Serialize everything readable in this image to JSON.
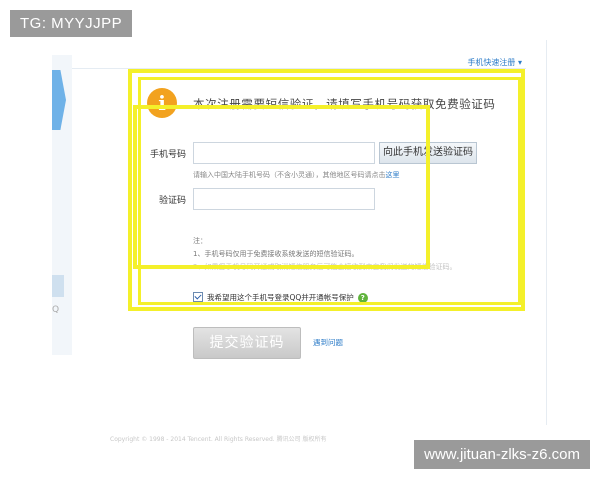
{
  "watermark": {
    "top_left": "TG: MYYJJPP",
    "bottom_right": "www.jituan-zlks-z6.com"
  },
  "top_link": "手机快速注册 ▾",
  "left_search_glyph": "Q",
  "header": {
    "info_symbol": "i",
    "text": "本次注册需要短信验证，请填写手机号码获取免费验证码"
  },
  "phone": {
    "label": "手机号码",
    "value": "",
    "send_button": "向此手机发送验证码",
    "hint_prefix": "请输入中国大陆手机号码（不含小灵通），其他地区号码请点击",
    "hint_link": "这里"
  },
  "code": {
    "label": "验证码",
    "value": ""
  },
  "notes": {
    "title": "注：",
    "item1": "1、手机号码仅用于免费接收系统发送的短信验证码。",
    "item2": "2、如果您手机号码开通或取消短信服务后可能会接收到来自我们发送的短信验证码。"
  },
  "agree": {
    "checked": true,
    "label": "我希望用这个手机号登录QQ并开通帐号保护",
    "help_symbol": "?"
  },
  "submit": {
    "label": "提交验证码",
    "help_link": "遇到问题"
  },
  "footer_blur": "Copyright © 1998 - 2014 Tencent. All Rights Reserved. 腾讯公司 版权所有",
  "colors": {
    "highlight": "#f4f02a",
    "accent": "#2d7cc8",
    "info": "#f2a21f",
    "help": "#5fb33c"
  }
}
